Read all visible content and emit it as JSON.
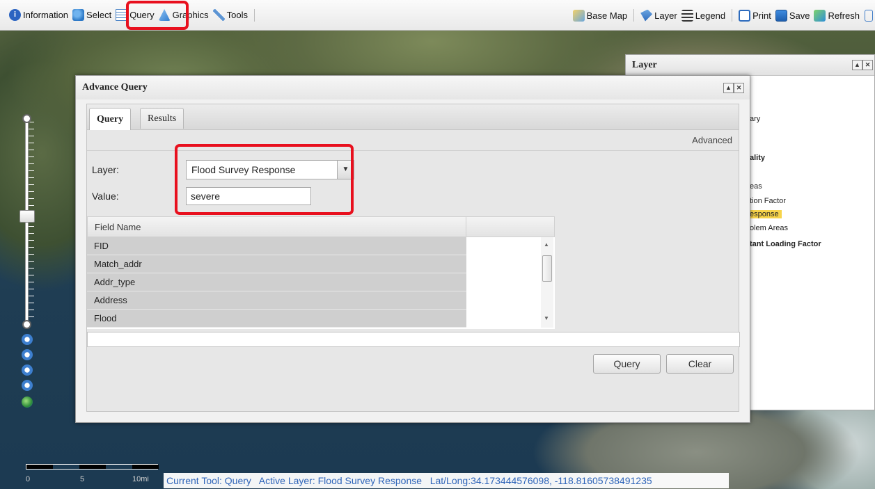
{
  "toolbar": {
    "left_items": [
      {
        "label": "Information",
        "icon": "info-icon",
        "color": "#2b63c1"
      },
      {
        "label": "Select",
        "icon": "select-icon",
        "color": "#3a87d8"
      },
      {
        "label": "Query",
        "icon": "query-icon",
        "color": "#4a83c6"
      },
      {
        "label": "Graphics",
        "icon": "graphics-icon",
        "color": "#3d8ad8"
      },
      {
        "label": "Tools",
        "icon": "wrench-icon",
        "color": "#5d95d4"
      }
    ],
    "right_items": [
      {
        "label": "Base Map",
        "icon": "basemap-icon"
      },
      {
        "label": "Layer",
        "icon": "layer-icon"
      },
      {
        "label": "Legend",
        "icon": "legend-icon"
      },
      {
        "label": "Print",
        "icon": "print-icon"
      },
      {
        "label": "Save",
        "icon": "save-icon"
      },
      {
        "label": "Refresh",
        "icon": "refresh-icon"
      }
    ]
  },
  "layer_panel": {
    "title": "Layer",
    "items": [
      {
        "text": "ary",
        "bold": false
      },
      {
        "text": "ality",
        "bold": true
      },
      {
        "text": "eas",
        "bold": false
      },
      {
        "text": "tion Factor",
        "bold": false
      },
      {
        "text": "esponse",
        "bold": false,
        "highlight": "#f7d44a"
      },
      {
        "text": "olem Areas",
        "bold": false
      },
      {
        "text": "tant Loading Factor",
        "bold": true
      }
    ]
  },
  "dialog": {
    "title": "Advance Query",
    "tabs": {
      "query": "Query",
      "results": "Results"
    },
    "advanced_link": "Advanced",
    "layer_label": "Layer:",
    "layer_value": "Flood Survey Response",
    "value_label": "Value:",
    "value_input": "severe",
    "grid": {
      "header": "Field Name",
      "rows": [
        "FID",
        "Match_addr",
        "Addr_type",
        "Address",
        "Flood"
      ]
    },
    "buttons": {
      "query": "Query",
      "clear": "Clear"
    }
  },
  "scale": {
    "labels": [
      "0",
      "5",
      "10mi"
    ]
  },
  "status": "Current Tool: Query   Active Layer: Flood Survey Response   Lat/Long:34.173444576098, -118.81605738491235",
  "accent": "#e8101e"
}
